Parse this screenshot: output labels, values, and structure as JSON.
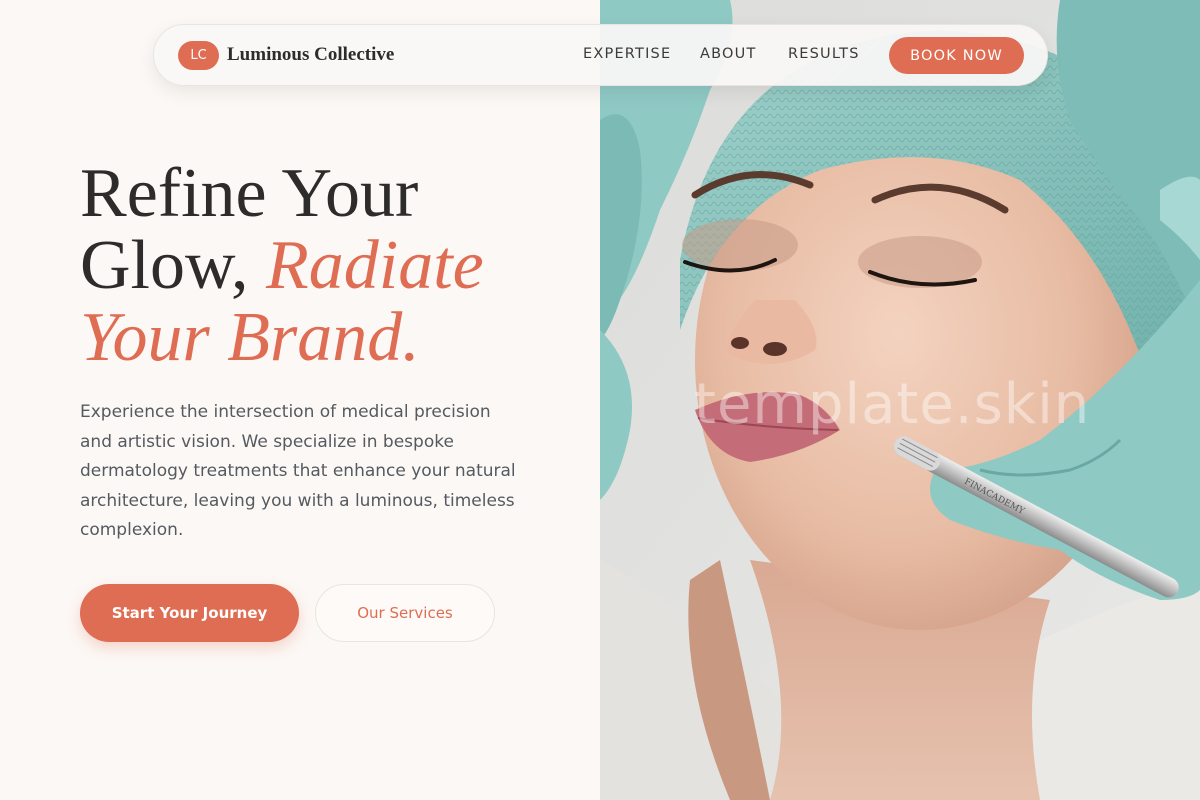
{
  "nav": {
    "logo_initials": "LC",
    "brand_name": "Luminous Collective",
    "links": [
      "EXPERTISE",
      "ABOUT",
      "RESULTS"
    ],
    "cta_label": "BOOK NOW"
  },
  "hero": {
    "title_line1": "Refine Your",
    "title_line2_plain": "Glow, ",
    "title_line2_accent": "Radiate",
    "title_line3_accent": "Your Brand.",
    "description": "Experience the intersection of medical precision and artistic vision. We specialize in bespoke dermatology treatments that enhance your natural architecture, leaving you with a luminous, timeless complexion.",
    "primary_button": "Start Your Journey",
    "secondary_button": "Our Services"
  },
  "image": {
    "watermark": "template.skin",
    "tool_engraving": "FINACADEMY"
  },
  "colors": {
    "accent": "#df6d53",
    "background": "#fcf8f5",
    "heading": "#2e2c2a",
    "body_text": "#555a60",
    "glove": "#8fc9c4"
  }
}
